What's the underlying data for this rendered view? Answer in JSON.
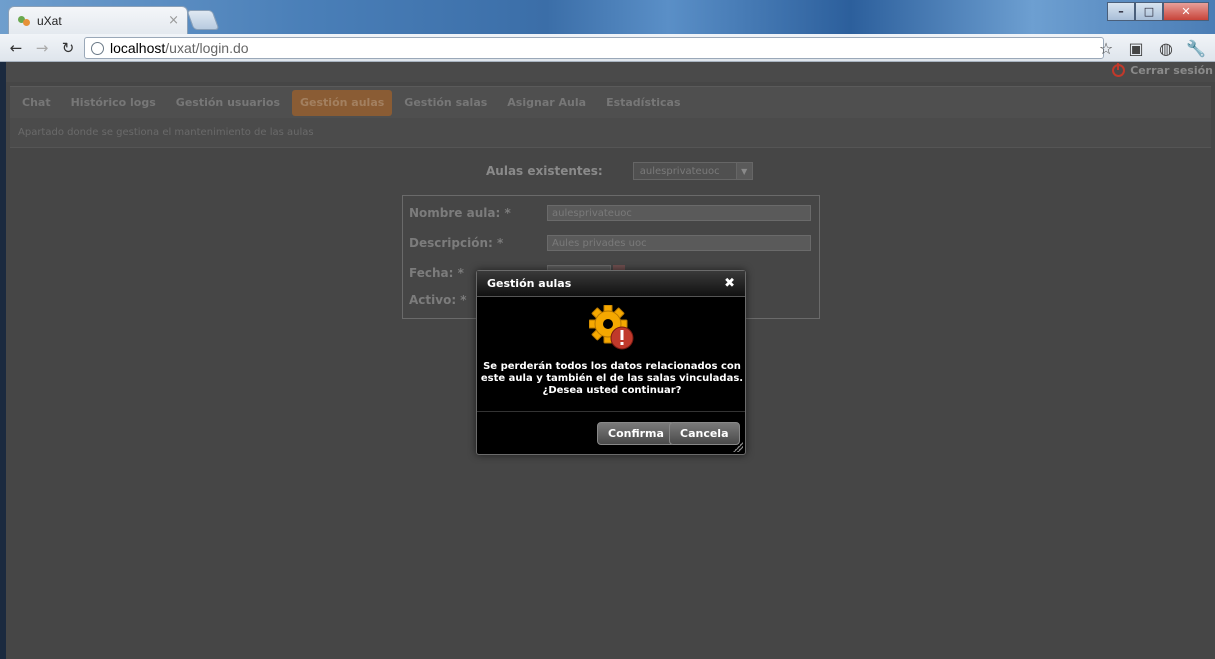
{
  "browser": {
    "tab_title": "uXat",
    "tab_close": "×",
    "url_host": "localhost",
    "url_path": "/uxat/login.do"
  },
  "app": {
    "logout_label": "Cerrar sesión",
    "nav_tabs": [
      {
        "label": "Chat"
      },
      {
        "label": "Histórico logs"
      },
      {
        "label": "Gestión usuarios"
      },
      {
        "label": "Gestión aulas",
        "active": true
      },
      {
        "label": "Gestión salas"
      },
      {
        "label": "Asignar Aula"
      },
      {
        "label": "Estadísticas"
      }
    ],
    "subtitle": "Apartado donde se gestiona el mantenimiento de las aulas",
    "selector": {
      "label": "Aulas existentes:",
      "value": "aulesprivateuoc"
    },
    "form": {
      "name_label": "Nombre aula: *",
      "name_value": "aulesprivateuoc",
      "desc_label": "Descripción: *",
      "desc_value": "Aules privades uoc",
      "date_label": "Fecha: *",
      "active_label": "Activo: *"
    }
  },
  "dialog": {
    "title": "Gestión aulas",
    "close": "✖",
    "message_line1": "Se perderán todos los datos relacionados con",
    "message_line2": "este aula y también el de las salas vinculadas.",
    "message_line3": "¿Desea usted continuar?",
    "confirm_label": "Confirma",
    "cancel_label": "Cancela"
  },
  "colors": {
    "active_tab": "#8a5c34",
    "app_bg": "#464646",
    "dialog_bg": "#000000",
    "warning_gear": "#f5a800",
    "alert_red": "#c0392b"
  },
  "icons": [
    "globe-icon",
    "star-icon",
    "wrench-icon",
    "power-icon",
    "gear-warning-icon",
    "close-icon",
    "resize-grip-icon"
  ]
}
